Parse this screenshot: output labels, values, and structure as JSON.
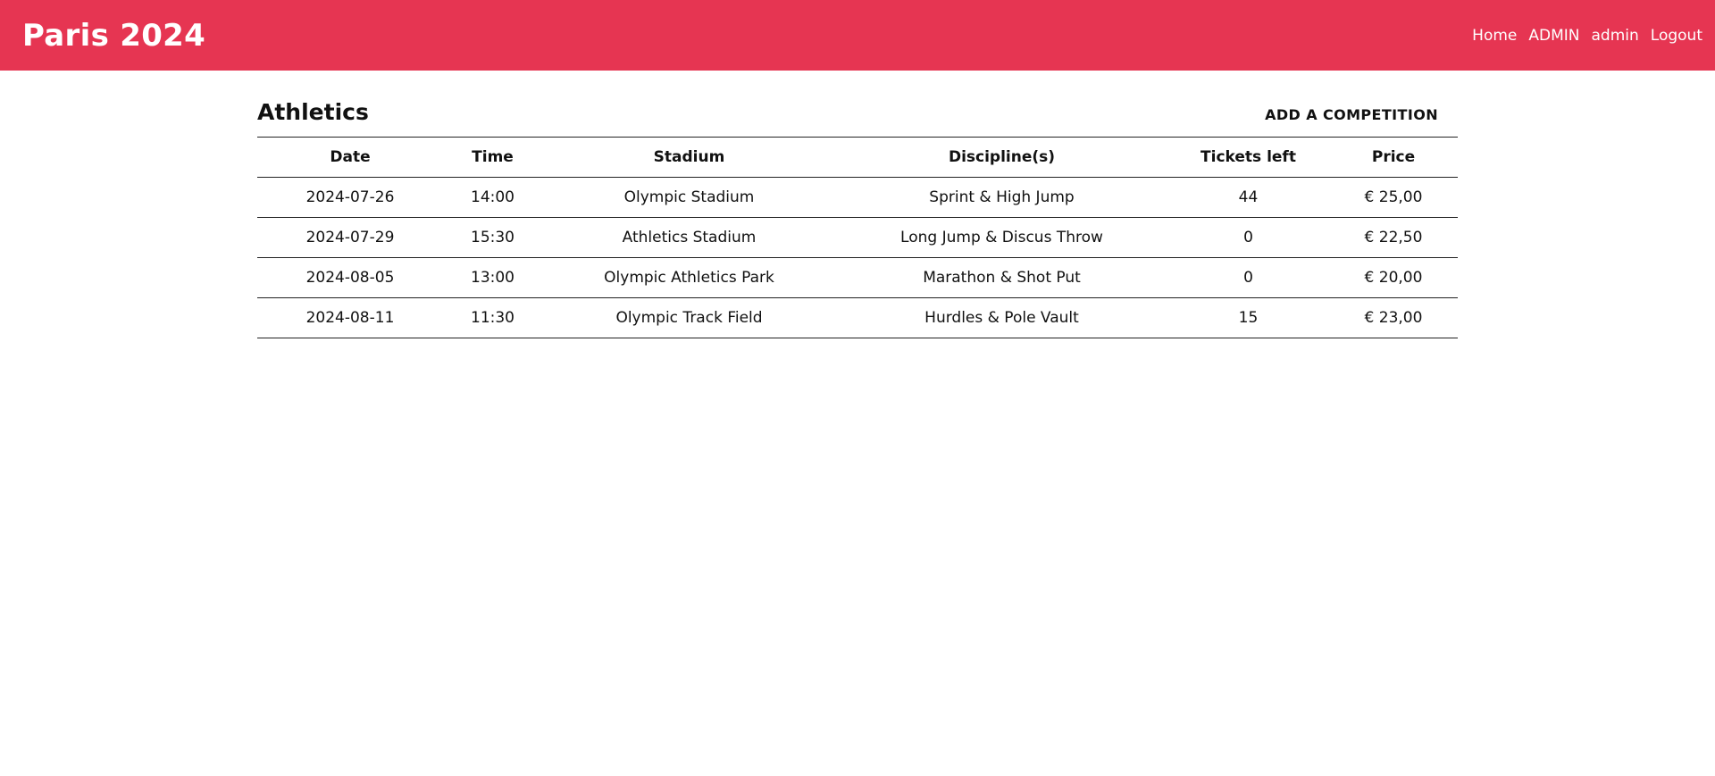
{
  "header": {
    "brand": "Paris 2024",
    "nav": {
      "home": "Home",
      "admin_upper": "ADMIN",
      "user": "admin",
      "logout": "Logout"
    }
  },
  "main": {
    "title": "Athletics",
    "add_label": "ADD A COMPETITION",
    "table": {
      "columns": [
        "Date",
        "Time",
        "Stadium",
        "Discipline(s)",
        "Tickets left",
        "Price"
      ],
      "rows": [
        [
          "2024-07-26",
          "14:00",
          "Olympic Stadium",
          "Sprint & High Jump",
          "44",
          "€ 25,00"
        ],
        [
          "2024-07-29",
          "15:30",
          "Athletics Stadium",
          "Long Jump & Discus Throw",
          "0",
          "€ 22,50"
        ],
        [
          "2024-08-05",
          "13:00",
          "Olympic Athletics Park",
          "Marathon & Shot Put",
          "0",
          "€ 20,00"
        ],
        [
          "2024-08-11",
          "11:30",
          "Olympic Track Field",
          "Hurdles & Pole Vault",
          "15",
          "€ 23,00"
        ]
      ]
    }
  },
  "colors": {
    "header_bg": "#e63552",
    "header_text": "#ffffff",
    "text": "#111111",
    "rule": "#222222"
  }
}
